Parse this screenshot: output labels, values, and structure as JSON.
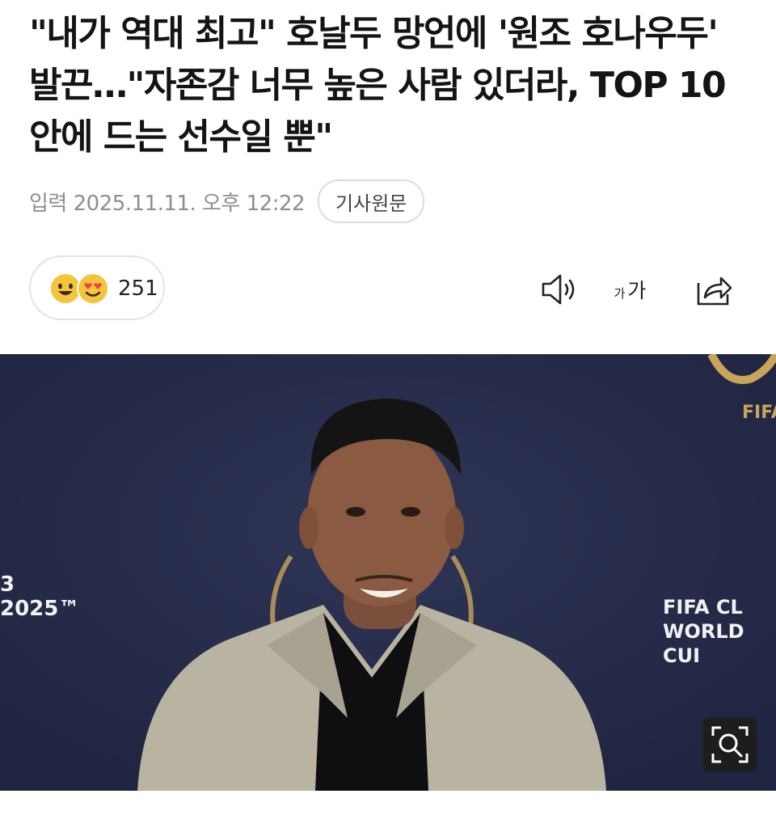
{
  "article": {
    "headline": "\"내가 역대 최고\" 호날두 망언에 '원조 호나우두' 발끈…\"자존감 너무 높은 사람 있더라, TOP 10 안에 드는 선수일 뿐\"",
    "dateline": "입력 2025.11.11. 오후 12:22",
    "source_button": "기사원문"
  },
  "reactions": {
    "count": "251",
    "emojis": [
      "smile-emoji",
      "heart-eyes-emoji"
    ]
  },
  "toolbar": {
    "tts_icon": "speaker-icon",
    "font_size_label_small": "가",
    "font_size_label_large": "가",
    "share_icon": "share-icon"
  },
  "photo": {
    "backdrop_left": "3\n2025™",
    "backdrop_right": "FIFA CL\nWORLD CUI",
    "backdrop_logo": "FIFA",
    "zoom_icon": "zoom-icon"
  },
  "colors": {
    "text": "#141414",
    "meta": "#8e8e8e",
    "backdrop": "#262b44",
    "emoji": "#f6c43a"
  }
}
